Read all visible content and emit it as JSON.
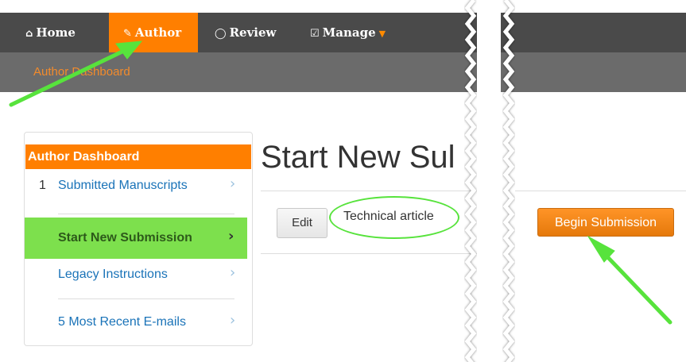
{
  "nav": {
    "home": "Home",
    "author": "Author",
    "review": "Review",
    "manage": "Manage"
  },
  "subnav": {
    "link": "Author Dashboard"
  },
  "sidebar": {
    "header": "Author Dashboard",
    "items": [
      {
        "count": "1",
        "label": "Submitted Manuscripts"
      },
      {
        "count": "",
        "label": "Start New Submission"
      },
      {
        "count": "",
        "label": "Legacy Instructions"
      },
      {
        "count": "",
        "label": "5 Most Recent E-mails"
      }
    ]
  },
  "main": {
    "title": "Start New Sul",
    "edit_label": "Edit",
    "type_label": "Technical article",
    "begin_label": "Begin Submission"
  },
  "colors": {
    "accent": "#ff7f00",
    "nav_bg": "#4a4a4a",
    "annotation": "#57e33c",
    "link": "#1a73b8"
  },
  "icons": [
    "home-icon",
    "pencil-icon",
    "comment-icon",
    "checkbox-icon",
    "caret-down-icon",
    "chevron-right-icon"
  ]
}
